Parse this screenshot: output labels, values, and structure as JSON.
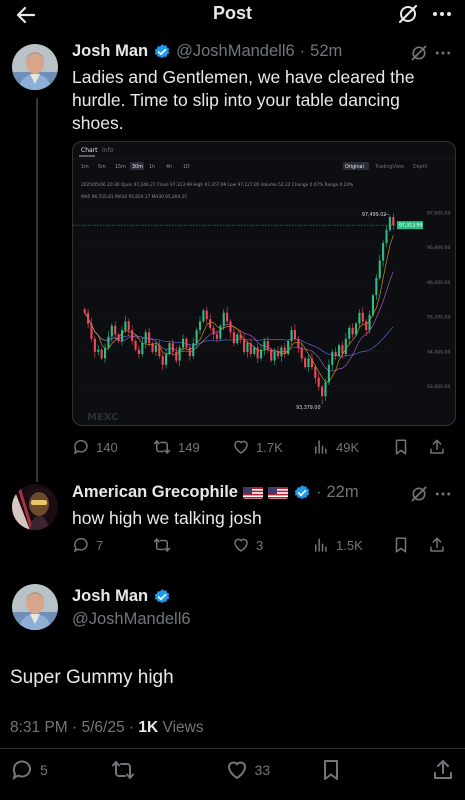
{
  "header": {
    "title": "Post"
  },
  "parent_tweet": {
    "display_name": "Josh Man",
    "handle": "@JoshMandell6",
    "time": "52m",
    "separator": "·",
    "text": "Ladies and Gentlemen, we have cleared the hurdle.  Time to slip into your table dancing shoes.",
    "replies": "140",
    "reposts": "149",
    "likes": "1.7K",
    "views": "49K"
  },
  "embedded_chart": {
    "tabs": [
      "Chart",
      "Info"
    ],
    "intervals": [
      "1m",
      "5m",
      "15m",
      "30m",
      "1h",
      "4h",
      "1D"
    ],
    "selected_interval": "30m",
    "view_modes": [
      "Original",
      "TradingView",
      "Depth"
    ],
    "ohlc_line": "2025/05/06 20:30  Open 97,246.27  Close 97,313.99  High 97,357.99  Low 97,127.05  Volume 52.22  Change 0.07%  Range 0.24%",
    "ma_line": "MA5 96,555.81  MA10 95,859.17  MA30 95,204.25",
    "watermark": "MEXC",
    "high_label": "97,499.02",
    "low_label": "93,379.00",
    "current_price_tag": "97,313.99",
    "price_axis": [
      "97,600.00",
      "96,800.00",
      "96,000.00",
      "95,200.00",
      "94,400.00",
      "93,600.00"
    ],
    "colors": {
      "up": "#2ebd85",
      "down": "#f6465d",
      "ma5": "#f0b90b",
      "ma10": "#c86bd8",
      "ma30": "#6c7cff"
    }
  },
  "chart_data": {
    "type": "candlestick",
    "title": "",
    "ylim": [
      93200,
      97800
    ],
    "close_series": [
      95300,
      95050,
      94700,
      94400,
      94450,
      94250,
      94500,
      94750,
      95000,
      94800,
      94650,
      94900,
      95100,
      94900,
      94650,
      94450,
      94350,
      94600,
      94850,
      94600,
      94400,
      94550,
      94300,
      94100,
      94350,
      94600,
      94400,
      94200,
      94500,
      94700,
      94500,
      94300,
      94600,
      94900,
      95100,
      95350,
      95150,
      94950,
      94800,
      94700,
      95000,
      95300,
      95100,
      94850,
      94600,
      94800,
      94700,
      94400,
      94600,
      94350,
      94500,
      94250,
      94450,
      94650,
      94450,
      94200,
      94400,
      94300,
      94500,
      94350,
      94650,
      94900,
      94700,
      94500,
      94250,
      94050,
      94250,
      94050,
      93800,
      93600,
      93380,
      93700,
      94100,
      94400,
      94300,
      94550,
      94350,
      94700,
      94950,
      94800,
      95050,
      95300,
      95100,
      94900,
      95250,
      95700,
      96100,
      96500,
      96900,
      97200,
      97499,
      97314
    ]
  },
  "reply": {
    "display_name": "American Grecophile",
    "handle_time": "22m",
    "separator": "·",
    "text": "how high we talking josh",
    "replies": "7",
    "reposts": "",
    "likes": "3",
    "views": "1.5K"
  },
  "main_tweet": {
    "display_name": "Josh Man",
    "handle": "@JoshMandell6",
    "text": "Super Gummy high",
    "timestamp": "8:31 PM · 5/6/25 · ",
    "views_count": "1K",
    "views_label": " Views",
    "replies": "5",
    "reposts": "",
    "likes": "33"
  }
}
